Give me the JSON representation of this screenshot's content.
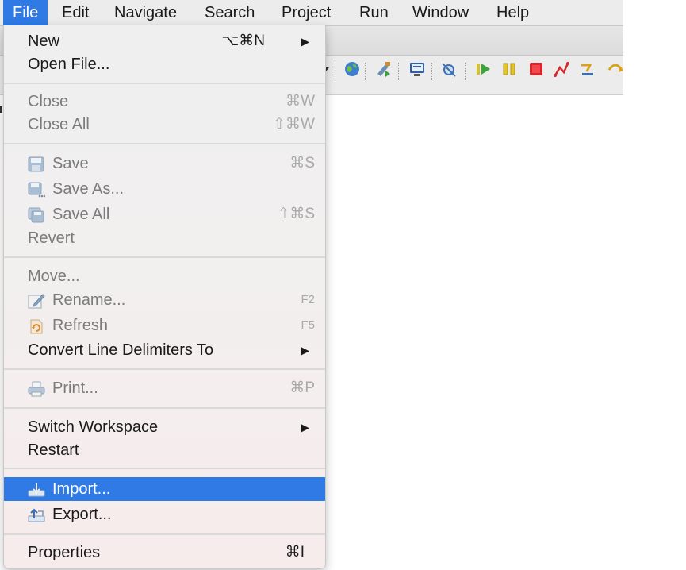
{
  "menubar": {
    "items": [
      "File",
      "Edit",
      "Navigate",
      "Search",
      "Project",
      "Run",
      "Window",
      "Help"
    ],
    "active": "File"
  },
  "file_menu": {
    "new": {
      "label": "New",
      "shortcut": "⌥⌘N"
    },
    "open_file": {
      "label": "Open File..."
    },
    "close": {
      "label": "Close",
      "shortcut": "⌘W"
    },
    "close_all": {
      "label": "Close All",
      "shortcut": "⇧⌘W"
    },
    "save": {
      "label": "Save",
      "shortcut": "⌘S",
      "icon": "save-icon"
    },
    "save_as": {
      "label": "Save As...",
      "icon": "save-as-icon"
    },
    "save_all": {
      "label": "Save All",
      "shortcut": "⇧⌘S",
      "icon": "save-all-icon"
    },
    "revert": {
      "label": "Revert"
    },
    "move": {
      "label": "Move..."
    },
    "rename": {
      "label": "Rename...",
      "shortcut": "F2",
      "icon": "rename-icon"
    },
    "refresh": {
      "label": "Refresh",
      "shortcut": "F5",
      "icon": "refresh-icon"
    },
    "convert": {
      "label": "Convert Line Delimiters To"
    },
    "print": {
      "label": "Print...",
      "shortcut": "⌘P",
      "icon": "print-icon"
    },
    "switch_workspace": {
      "label": "Switch Workspace"
    },
    "restart": {
      "label": "Restart"
    },
    "import": {
      "label": "Import...",
      "icon": "import-icon"
    },
    "export": {
      "label": "Export...",
      "icon": "export-icon"
    },
    "properties": {
      "label": "Properties",
      "shortcut": "⌘I"
    }
  },
  "toolbar_icons": [
    "globe-icon",
    "external-tools-icon",
    "display-icon",
    "skip-breakpoints-icon",
    "resume-icon",
    "suspend-icon",
    "terminate-icon",
    "disconnect-icon",
    "step-into-icon",
    "step-over-icon"
  ],
  "colors": {
    "highlight": "#2f7ae5",
    "menu_bg": "#efeff0",
    "shortcut_gray": "#a9a9a9",
    "disabled_text": "#7b7b7b"
  }
}
